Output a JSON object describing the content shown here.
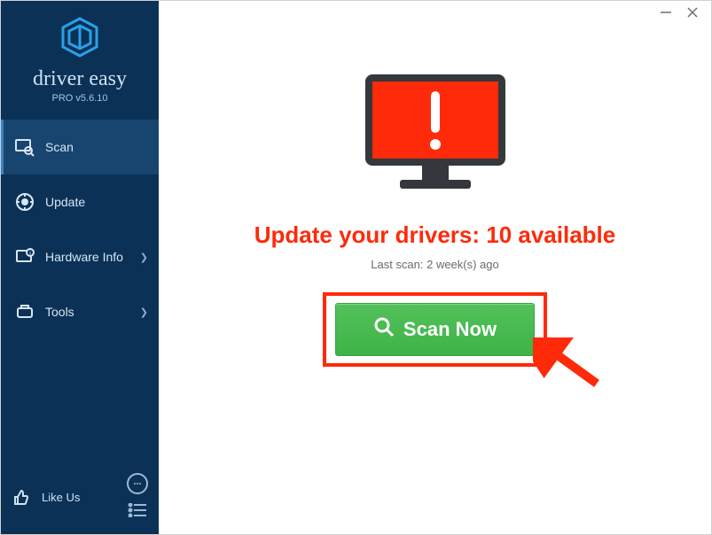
{
  "brand": {
    "name": "driver easy",
    "version": "PRO v5.6.10"
  },
  "sidebar": {
    "items": [
      {
        "label": "Scan",
        "icon": "scan-icon",
        "active": true,
        "chevron": false
      },
      {
        "label": "Update",
        "icon": "update-icon",
        "active": false,
        "chevron": false
      },
      {
        "label": "Hardware Info",
        "icon": "hw-icon",
        "active": false,
        "chevron": true
      },
      {
        "label": "Tools",
        "icon": "tools-icon",
        "active": false,
        "chevron": true
      }
    ],
    "like_label": "Like Us"
  },
  "main": {
    "headline": "Update your drivers: 10 available",
    "subline": "Last scan: 2 week(s) ago",
    "scan_label": "Scan Now"
  },
  "colors": {
    "alert": "#fe2a0a",
    "scan_green": "#42b74f"
  }
}
